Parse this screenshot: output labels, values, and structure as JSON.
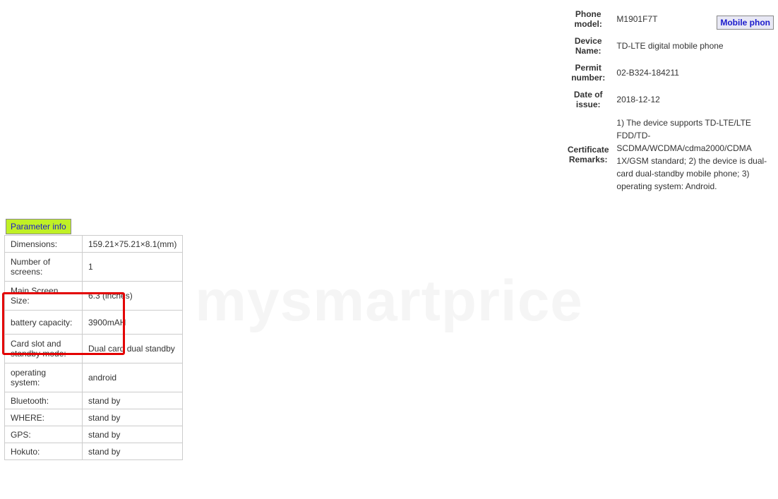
{
  "watermark": "mysmartprice",
  "mobile_button": "Mobile phon",
  "header_rows": [
    {
      "label": "Phone model:",
      "value": "M1901F7T"
    },
    {
      "label": "Device Name:",
      "value": "TD-LTE digital mobile phone"
    },
    {
      "label": "Permit number:",
      "value": "02-B324-184211"
    },
    {
      "label": "Date of issue:",
      "value": "2018-12-12"
    },
    {
      "label": "Certificate Remarks:",
      "value": "1) The device supports TD-LTE/LTE FDD/TD-SCDMA/WCDMA/cdma2000/CDMA 1X/GSM standard; 2) the device is dual-card dual-standby mobile phone; 3) operating system: Android."
    }
  ],
  "param_badge": "Parameter info",
  "specs": [
    {
      "label": "Dimensions:",
      "value": "159.21×75.21×8.1(mm)"
    },
    {
      "label": "Number of screens:",
      "value": "1"
    },
    {
      "label": "Main Screen Size:",
      "value": "6.3 (inches)"
    },
    {
      "label": "battery capacity:",
      "value": "3900mAH"
    },
    {
      "label": "Card slot and standby mode:",
      "value": "Dual card dual standby"
    },
    {
      "label": "operating system:",
      "value": "android"
    },
    {
      "label": "Bluetooth:",
      "value": "stand by"
    },
    {
      "label": "WHERE:",
      "value": "stand by"
    },
    {
      "label": "GPS:",
      "value": "stand by"
    },
    {
      "label": "Hokuto:",
      "value": "stand by"
    }
  ]
}
